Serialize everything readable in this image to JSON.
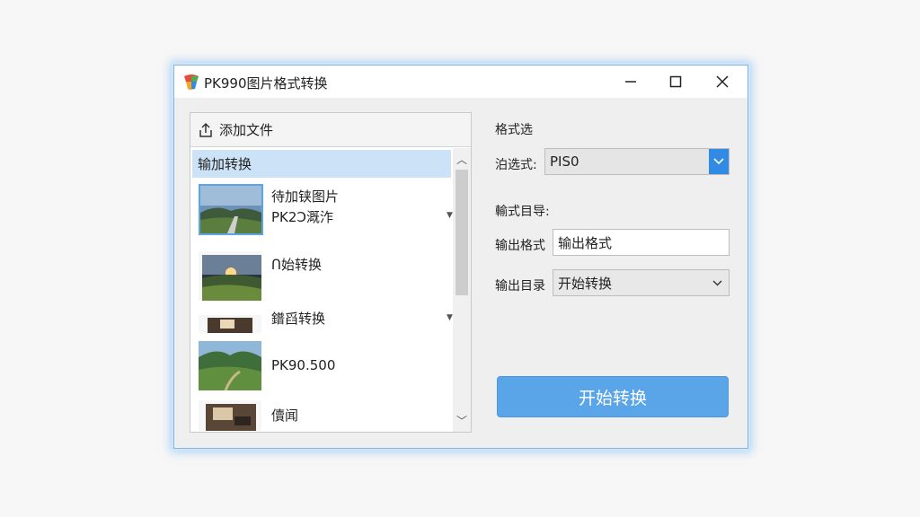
{
  "window": {
    "title": "PK990图片格式转换"
  },
  "left_panel": {
    "add_file_label": "添加文件",
    "list_header": "输加转换",
    "items": [
      {
        "line1": "待加铗图片",
        "line2": "PK2Ɔ溉泎"
      },
      {
        "line1": "ᑎ始转换"
      },
      {
        "line1": "鐠舀转换"
      },
      {
        "line1": "PK90.500"
      },
      {
        "line1": "儥闻"
      }
    ]
  },
  "right_panel": {
    "format_section_title": "格式选",
    "format_label": "泊选式:",
    "format_value": "PIS0",
    "output_section_title": "輸式目导:",
    "output_format_label": "输出格式",
    "output_format_value": "输出格式",
    "output_dir_label": "输出目录",
    "output_dir_value": "开始转换",
    "start_button": "开始转换"
  },
  "colors": {
    "accent": "#2f8be6",
    "button": "#5aa5e8",
    "selection": "#cce3f7"
  }
}
